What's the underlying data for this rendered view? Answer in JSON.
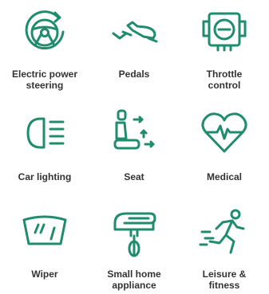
{
  "colors": {
    "icon": "#1f8c6d",
    "label": "#333333",
    "background": "#ffffff"
  },
  "items": [
    {
      "label": "Electric power\nsteering",
      "icon": "steering-wheel-icon"
    },
    {
      "label": "Pedals",
      "icon": "pedals-icon"
    },
    {
      "label": "Throttle\ncontrol",
      "icon": "throttle-control-icon"
    },
    {
      "label": "Car lighting",
      "icon": "car-light-icon"
    },
    {
      "label": "Seat",
      "icon": "seat-icon"
    },
    {
      "label": "Medical",
      "icon": "heart-pulse-icon"
    },
    {
      "label": "Wiper",
      "icon": "wiper-icon"
    },
    {
      "label": "Small home\nappliance",
      "icon": "hand-mixer-icon"
    },
    {
      "label": "Leisure &\nfitness",
      "icon": "runner-icon"
    }
  ]
}
